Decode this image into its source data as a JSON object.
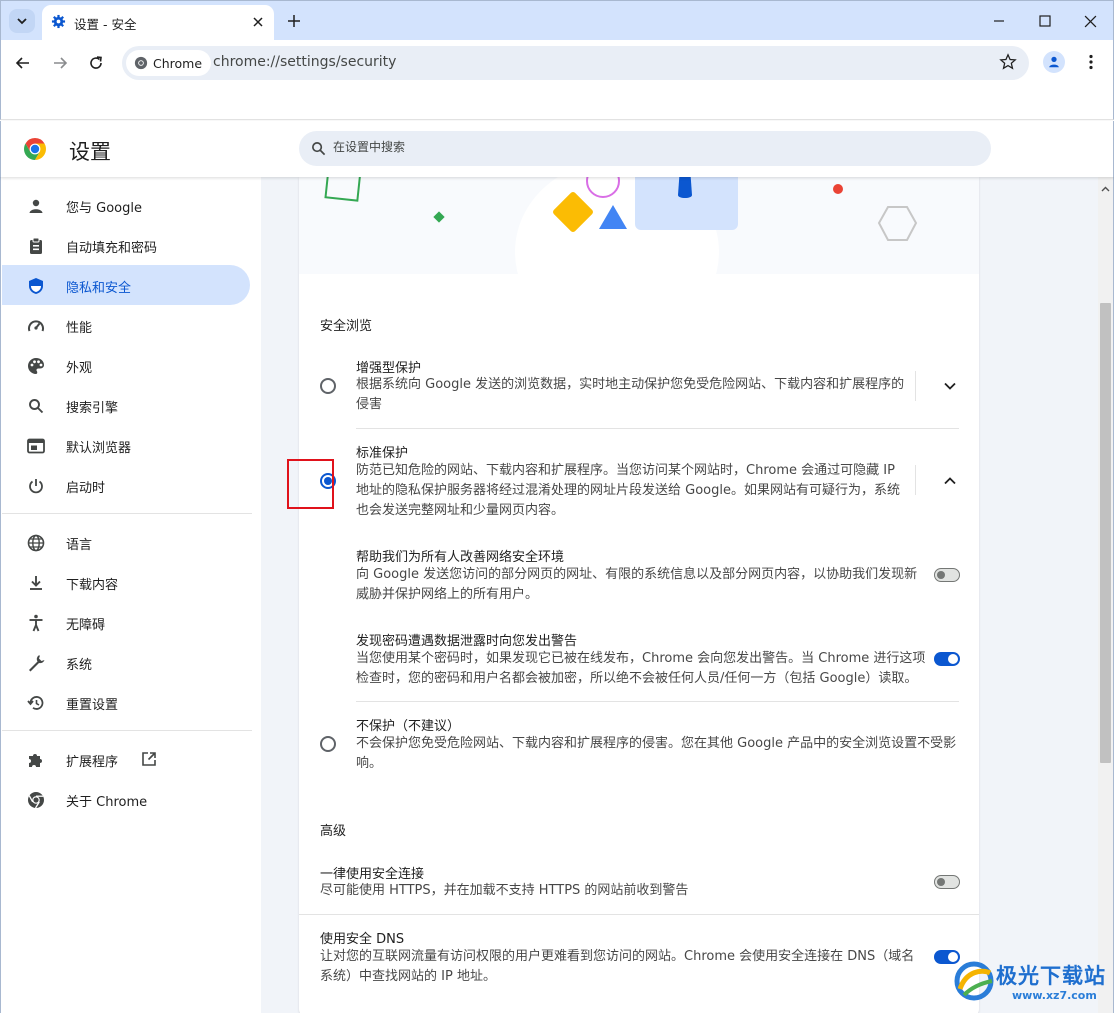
{
  "tab": {
    "title": "设置 - 安全"
  },
  "omnibox": {
    "chip_label": "Chrome",
    "url": "chrome://settings/security"
  },
  "header": {
    "title": "设置",
    "search_placeholder": "在设置中搜索"
  },
  "sidebar": {
    "items": [
      {
        "label": "您与 Google",
        "icon": "person-icon"
      },
      {
        "label": "自动填充和密码",
        "icon": "clipboard-icon"
      },
      {
        "label": "隐私和安全",
        "icon": "shield-icon",
        "active": true
      },
      {
        "label": "性能",
        "icon": "gauge-icon"
      },
      {
        "label": "外观",
        "icon": "palette-icon"
      },
      {
        "label": "搜索引擎",
        "icon": "search-icon"
      },
      {
        "label": "默认浏览器",
        "icon": "browser-icon"
      },
      {
        "label": "启动时",
        "icon": "power-icon"
      },
      {
        "label": "语言",
        "icon": "globe-icon"
      },
      {
        "label": "下载内容",
        "icon": "download-icon"
      },
      {
        "label": "无障碍",
        "icon": "accessibility-icon"
      },
      {
        "label": "系统",
        "icon": "wrench-icon"
      },
      {
        "label": "重置设置",
        "icon": "history-icon"
      },
      {
        "label": "扩展程序",
        "icon": "puzzle-icon"
      },
      {
        "label": "关于 Chrome",
        "icon": "chrome-icon"
      }
    ]
  },
  "main": {
    "safe_browsing_heading": "安全浏览",
    "enhanced": {
      "title": "增强型保护",
      "desc1": "根据系统向 Google 发送的浏览数据，实时地主动保护您免受危险网站、下载内容和扩展程序的",
      "desc2": "侵害",
      "selected": false
    },
    "standard": {
      "title": "标准保护",
      "desc1": "防范已知危险的网站、下载内容和扩展程序。当您访问某个网站时，Chrome 会通过可隐藏 IP",
      "desc2": "地址的隐私保护服务器将经过混淆处理的网址片段发送给 Google。如果网站有可疑行为，系统",
      "desc3": "也会发送完整网址和少量网页内容。",
      "selected": true
    },
    "help_improve": {
      "title": "帮助我们为所有人改善网络安全环境",
      "desc1": "向 Google 发送您访问的部分网页的网址、有限的系统信息以及部分网页内容，以协助我们发现新",
      "desc2": "威胁并保护网络上的所有用户。",
      "enabled": false
    },
    "password_leak": {
      "title": "发现密码遭遇数据泄露时向您发出警告",
      "desc1": "当您使用某个密码时，如果发现它已被在线发布，Chrome 会向您发出警告。当 Chrome 进行这项",
      "desc2": "检查时，您的密码和用户名都会被加密，所以绝不会被任何人员/任何一方（包括 Google）读取。",
      "enabled": true
    },
    "no_protection": {
      "title": "不保护（不建议）",
      "desc1": "不会保护您免受危险网站、下载内容和扩展程序的侵害。您在其他 Google 产品中的安全浏览设置不受影",
      "desc2": "响。",
      "selected": false
    },
    "advanced_heading": "高级",
    "https": {
      "title": "一律使用安全连接",
      "desc": "尽可能使用 HTTPS，并在加载不支持 HTTPS 的网站前收到警告",
      "enabled": false
    },
    "dns": {
      "title": "使用安全 DNS",
      "desc1": "让对您的互联网流量有访问权限的用户更难看到您访问的网站。Chrome 会使用安全连接在 DNS（域名",
      "desc2": "系统）中查找网站的 IP 地址。",
      "enabled": true
    }
  },
  "watermark": {
    "name": "极光下载站",
    "url": "www.xz7.com"
  },
  "colors": {
    "accent": "#0b57d0",
    "active_bg": "#d3e3fd",
    "highlight": "#e0121b"
  }
}
